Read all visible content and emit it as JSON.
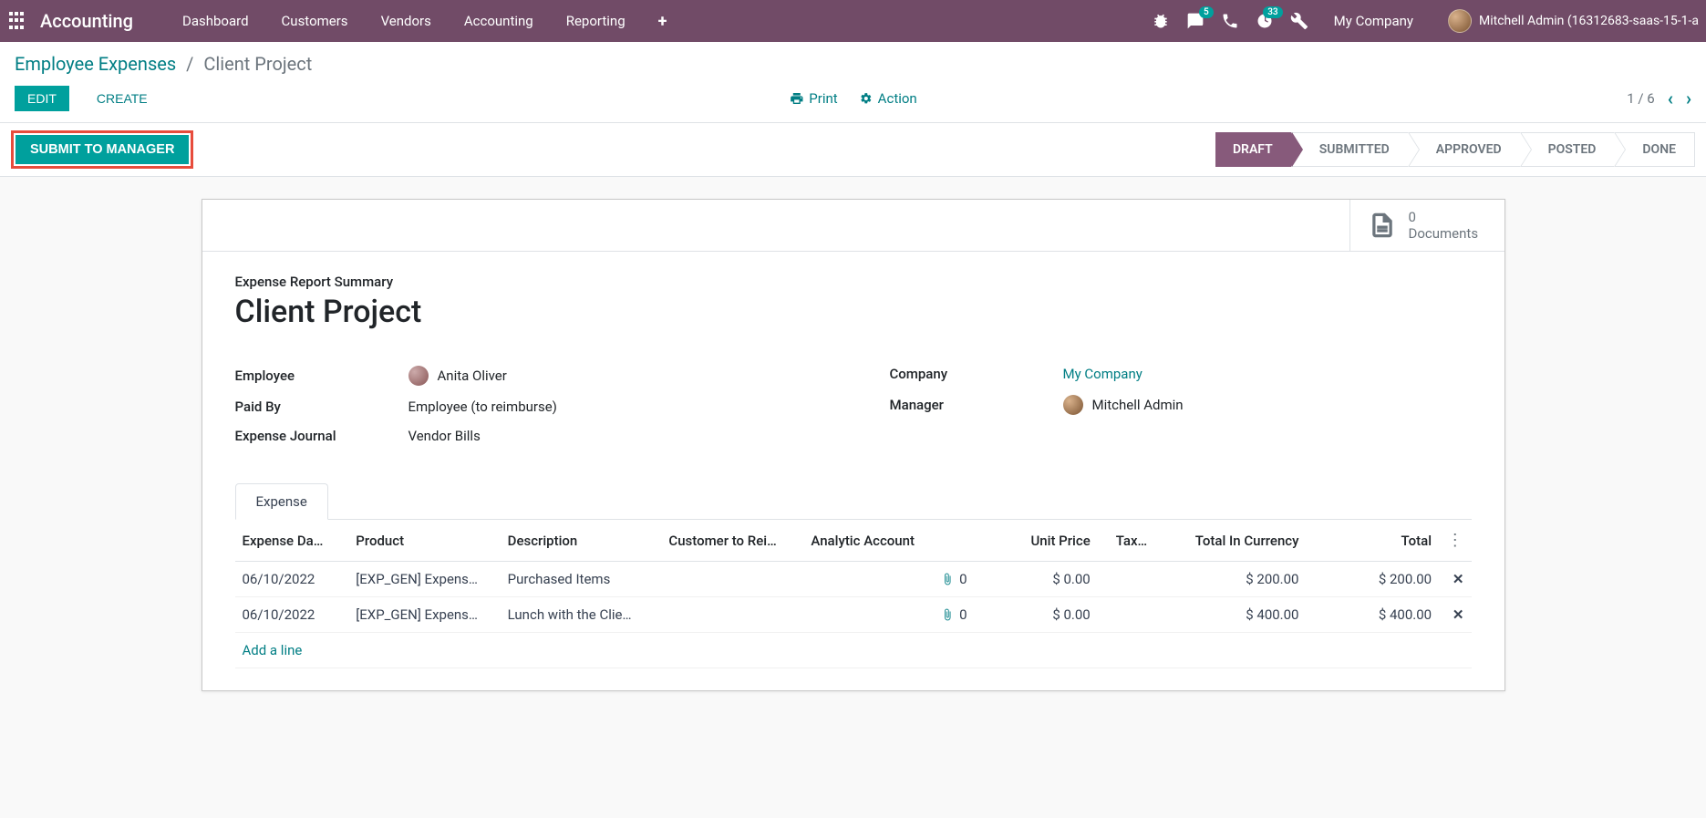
{
  "topbar": {
    "brand": "Accounting",
    "menu": [
      "Dashboard",
      "Customers",
      "Vendors",
      "Accounting",
      "Reporting"
    ],
    "messaging_badge": "5",
    "activities_badge": "33",
    "company": "My Company",
    "user_name": "Mitchell Admin (16312683-saas-15-1-a"
  },
  "breadcrumb": {
    "parent": "Employee Expenses",
    "current": "Client Project"
  },
  "buttons": {
    "edit": "Edit",
    "create": "Create",
    "print": "Print",
    "action": "Action",
    "submit": "Submit to Manager"
  },
  "pager": {
    "text": "1 / 6"
  },
  "stages": [
    "Draft",
    "Submitted",
    "Approved",
    "Posted",
    "Done"
  ],
  "active_stage_index": 0,
  "stat": {
    "count": "0",
    "label": "Documents"
  },
  "record": {
    "section_label": "Expense Report Summary",
    "title": "Client Project",
    "left_fields": [
      {
        "label": "Employee",
        "value": "Anita Oliver",
        "avatar": true
      },
      {
        "label": "Paid By",
        "value": "Employee (to reimburse)"
      },
      {
        "label": "Expense Journal",
        "value": "Vendor Bills"
      }
    ],
    "right_fields": [
      {
        "label": "Company",
        "value": "My Company",
        "link": true
      },
      {
        "label": "Manager",
        "value": "Mitchell Admin",
        "avatar": true,
        "avatar_b": true
      }
    ]
  },
  "tab": {
    "label": "Expense"
  },
  "table": {
    "headers": [
      "Expense Da…",
      "Product",
      "Description",
      "Customer to Rei…",
      "Analytic Account",
      "Unit Price",
      "Tax…",
      "Total In Currency",
      "Total"
    ],
    "rows": [
      {
        "date": "06/10/2022",
        "product": "[EXP_GEN] Expens…",
        "desc": "Purchased Items",
        "cust": "",
        "analytic_count": "0",
        "unit": "$ 0.00",
        "tax": "",
        "tic": "$ 200.00",
        "total": "$ 200.00"
      },
      {
        "date": "06/10/2022",
        "product": "[EXP_GEN] Expens…",
        "desc": "Lunch with the Clie…",
        "cust": "",
        "analytic_count": "0",
        "unit": "$ 0.00",
        "tax": "",
        "tic": "$ 400.00",
        "total": "$ 400.00"
      }
    ],
    "add_line": "Add a line"
  }
}
